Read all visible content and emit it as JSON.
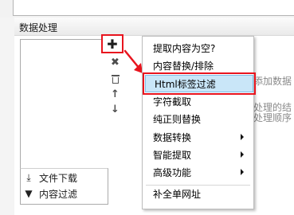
{
  "section": {
    "title": "数据处理"
  },
  "toolbox": {
    "add_icon": "plus-icon",
    "delete_icon": "close-icon",
    "trash_icon": "trash-icon",
    "up_icon": "arrow-up-icon",
    "down_icon": "arrow-down-icon"
  },
  "filters": [
    {
      "label": "文件下载",
      "icon": "download-icon"
    },
    {
      "label": "内容过滤",
      "icon": "filter-icon"
    }
  ],
  "right_hint": {
    "line1": "添加数据",
    "line2": "处理的结",
    "line3": "处理顺序"
  },
  "menu": {
    "items": [
      {
        "label": "提取内容为空?",
        "submenu": false
      },
      {
        "label": "内容替换/排除",
        "submenu": false
      },
      {
        "label": "Html标签过滤",
        "submenu": false,
        "highlighted": true
      },
      {
        "label": "字符截取",
        "submenu": false
      },
      {
        "label": "纯正则替换",
        "submenu": false
      },
      {
        "label": "数据转换",
        "submenu": true
      },
      {
        "label": "智能提取",
        "submenu": true
      },
      {
        "label": "高级功能",
        "submenu": true
      },
      {
        "label": "补全单网址",
        "submenu": false
      }
    ]
  },
  "colors": {
    "highlight_border": "#e8141e",
    "selected_bg": "#c9e6f8"
  }
}
